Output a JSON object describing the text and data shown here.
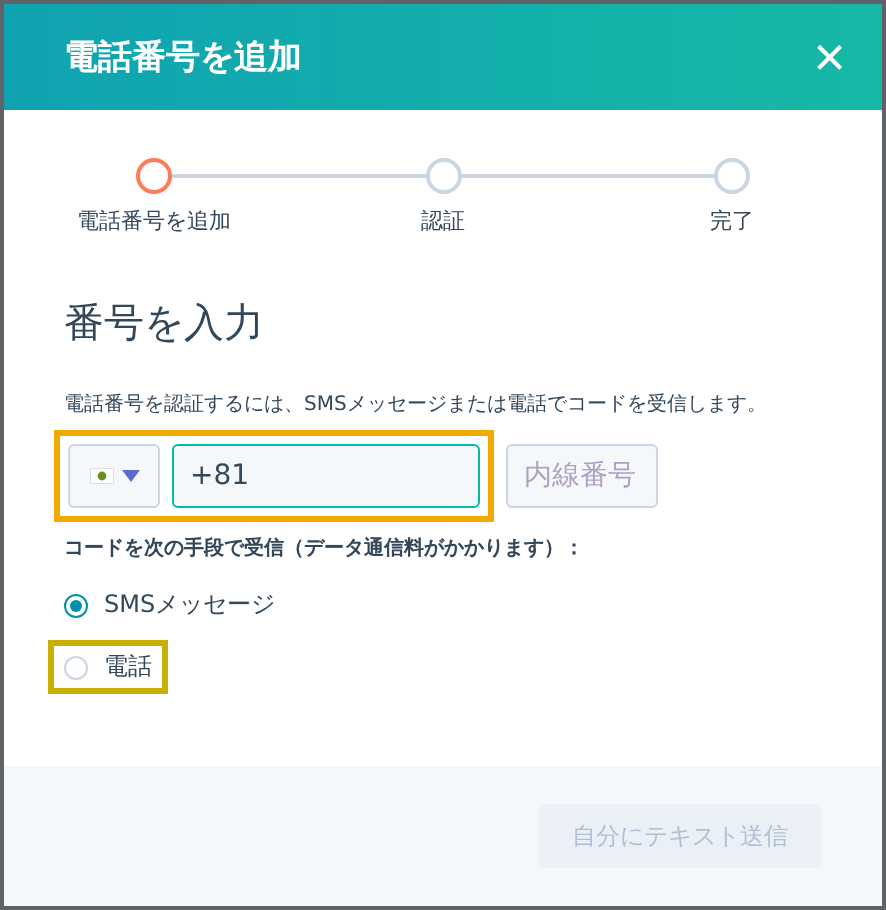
{
  "dialog": {
    "title": "電話番号を追加",
    "close": "×"
  },
  "steps": [
    {
      "label": "電話番号を追加",
      "current": true
    },
    {
      "label": "認証",
      "current": false
    },
    {
      "label": "完了",
      "current": false
    }
  ],
  "heading": "番号を入力",
  "description": "電話番号を認証するには、SMSメッセージまたは電話でコードを受信します。",
  "phone": {
    "value": "+81",
    "highlighted": true
  },
  "extension": {
    "placeholder": "内線番号"
  },
  "method_label": "コードを次の手段で受信（データ通信料がかかります）：",
  "methods": [
    {
      "label": "SMSメッセージ",
      "selected": true,
      "highlighted": false
    },
    {
      "label": "電話",
      "selected": false,
      "highlighted": true
    }
  ],
  "buttons": [
    {
      "label": "自分にテキスト送信",
      "disabled": true
    }
  ]
}
